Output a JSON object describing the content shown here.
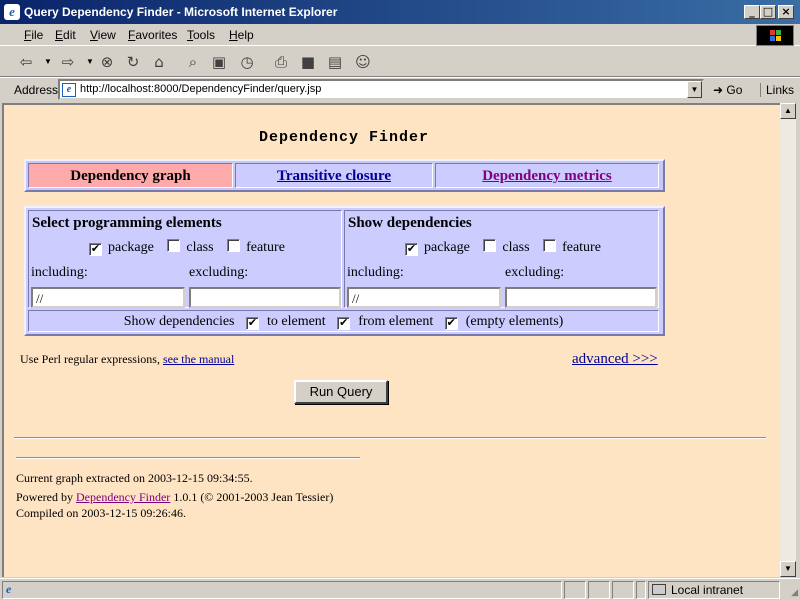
{
  "window": {
    "title": "Query Dependency Finder - Microsoft Internet Explorer"
  },
  "menu": {
    "file": "File",
    "edit": "Edit",
    "view": "View",
    "favorites": "Favorites",
    "tools": "Tools",
    "help": "Help"
  },
  "address": {
    "label": "Address",
    "url": "http://localhost:8000/DependencyFinder/query.jsp",
    "go": "Go",
    "links": "Links"
  },
  "page": {
    "heading": "Dependency Finder",
    "tabs": [
      {
        "label": "Dependency graph",
        "state": "active"
      },
      {
        "label": "Transitive closure",
        "state": "link"
      },
      {
        "label": "Dependency metrics",
        "state": "visited"
      }
    ],
    "select": {
      "header": "Select programming elements",
      "package": "package",
      "package_checked": true,
      "class": "class",
      "class_checked": false,
      "feature": "feature",
      "feature_checked": false,
      "including_label": "including:",
      "excluding_label": "excluding:",
      "including_value": "//",
      "excluding_value": ""
    },
    "show": {
      "header": "Show dependencies",
      "package": "package",
      "package_checked": true,
      "class": "class",
      "class_checked": false,
      "feature": "feature",
      "feature_checked": false,
      "including_label": "including:",
      "excluding_label": "excluding:",
      "including_value": "//",
      "excluding_value": ""
    },
    "show_row": {
      "label": "Show dependencies",
      "to_element": "to element",
      "from_element": "from element",
      "empty_elements": "(empty elements)"
    },
    "perl_note": "Use Perl regular expressions,",
    "manual_link": "see the manual",
    "advanced_link": "advanced >>>",
    "run_button": "Run Query",
    "footer": {
      "extracted": "Current graph extracted on 2003-12-15 09:34:55.",
      "powered_prefix": "Powered by",
      "powered_link": "Dependency Finder",
      "powered_suffix": "1.0.1 (© 2001-2003 Jean Tessier)",
      "compiled": "Compiled on 2003-12-15 09:26:46."
    }
  },
  "status": {
    "zone": "Local intranet"
  }
}
